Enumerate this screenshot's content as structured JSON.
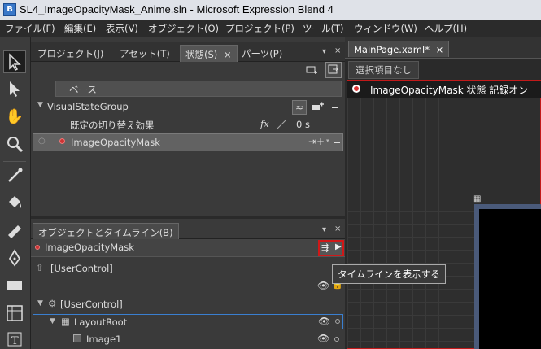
{
  "window": {
    "icon_label": "B",
    "title": "SL4_ImageOpacityMask_Anime.sln - Microsoft Expression Blend 4"
  },
  "menu": [
    "ファイル(F)",
    "編集(E)",
    "表示(V)",
    "オブジェクト(O)",
    "プロジェクト(P)",
    "ツール(T)",
    "ウィンドウ(W)",
    "ヘルプ(H)"
  ],
  "left_tabs": {
    "project": "プロジェクト(J)",
    "assets": "アセット(T)",
    "states": "状態(S)",
    "states_close": "×",
    "parts": "パーツ(P)",
    "pin": "▾",
    "close": "×"
  },
  "states": {
    "base_label": "ベース",
    "group_name": "VisualStateGroup",
    "transition_label": "既定の切り替え効果",
    "transition_duration": "0 s",
    "state_name": "ImageOpacityMask"
  },
  "objects_panel": {
    "title": "オブジェクトとタイムライン(B)",
    "pin": "▾",
    "close": "×",
    "current_state": "ImageOpacityMask",
    "scope": "[UserControl]",
    "tree": [
      {
        "label": "[UserControl]"
      },
      {
        "label": "LayoutRoot"
      },
      {
        "label": "Image1"
      }
    ]
  },
  "tooltip": "タイムラインを表示する",
  "document": {
    "tab_label": "MainPage.xaml*",
    "tab_close": "×",
    "selection_label": "選択項目なし",
    "recording_text": "ImageOpacityMask 状態 記録オン"
  },
  "colors": {
    "recording_red": "#c21a1a",
    "highlight_border": "#3a7fd0"
  }
}
